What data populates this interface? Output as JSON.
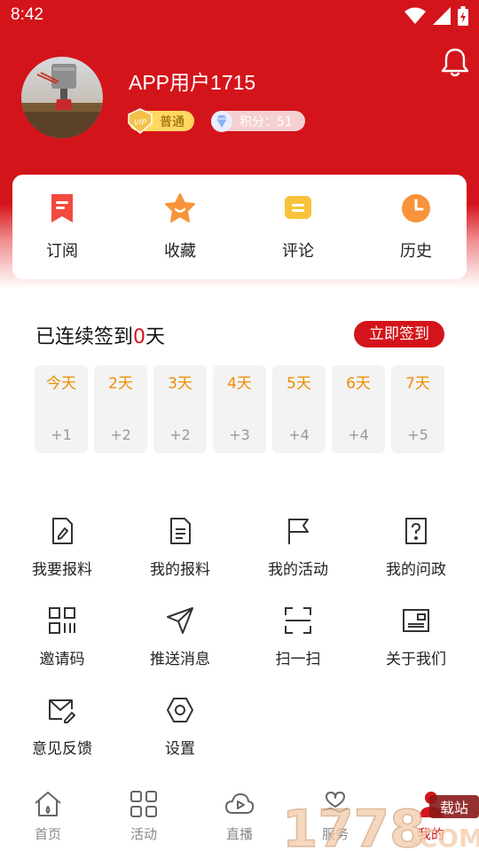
{
  "status_bar": {
    "time": "8:42"
  },
  "profile": {
    "username": "APP用户1715",
    "level_mark": "VIP",
    "level_label": "普通",
    "points_label": "积分：51"
  },
  "quick_actions": [
    {
      "label": "订阅",
      "icon": "subscribe-icon"
    },
    {
      "label": "收藏",
      "icon": "star-icon"
    },
    {
      "label": "评论",
      "icon": "comment-icon"
    },
    {
      "label": "历史",
      "icon": "history-clock-icon"
    }
  ],
  "signin": {
    "prefix": "已连续签到",
    "count": "0",
    "suffix": "天",
    "button_label": "立即签到",
    "days": [
      {
        "label": "今天",
        "points": "+1"
      },
      {
        "label": "2天",
        "points": "+2"
      },
      {
        "label": "3天",
        "points": "+2"
      },
      {
        "label": "4天",
        "points": "+3"
      },
      {
        "label": "5天",
        "points": "+4"
      },
      {
        "label": "6天",
        "points": "+4"
      },
      {
        "label": "7天",
        "points": "+5"
      }
    ]
  },
  "menu": [
    {
      "label": "我要报料",
      "icon": "edit-document-icon"
    },
    {
      "label": "我的报料",
      "icon": "document-icon"
    },
    {
      "label": "我的活动",
      "icon": "flag-icon"
    },
    {
      "label": "我的问政",
      "icon": "question-document-icon"
    },
    {
      "label": "邀请码",
      "icon": "qr-code-icon"
    },
    {
      "label": "推送消息",
      "icon": "send-icon"
    },
    {
      "label": "扫一扫",
      "icon": "scan-icon"
    },
    {
      "label": "关于我们",
      "icon": "about-card-icon"
    },
    {
      "label": "意见反馈",
      "icon": "feedback-mail-icon"
    },
    {
      "label": "设置",
      "icon": "settings-icon"
    }
  ],
  "tabbar": [
    {
      "label": "首页",
      "icon": "home-icon",
      "active": false
    },
    {
      "label": "活动",
      "icon": "grid-icon",
      "active": false
    },
    {
      "label": "直播",
      "icon": "live-cloud-icon",
      "active": false
    },
    {
      "label": "服务",
      "icon": "service-icon",
      "active": false
    },
    {
      "label": "我的",
      "icon": "user-icon",
      "active": true
    }
  ],
  "watermark": {
    "text": "1778",
    "suffix": ".COM",
    "tag": "载站"
  },
  "colors": {
    "brand_red": "#d4141b",
    "day_label": "#f08c00",
    "badge_gold": "#ffd761"
  }
}
